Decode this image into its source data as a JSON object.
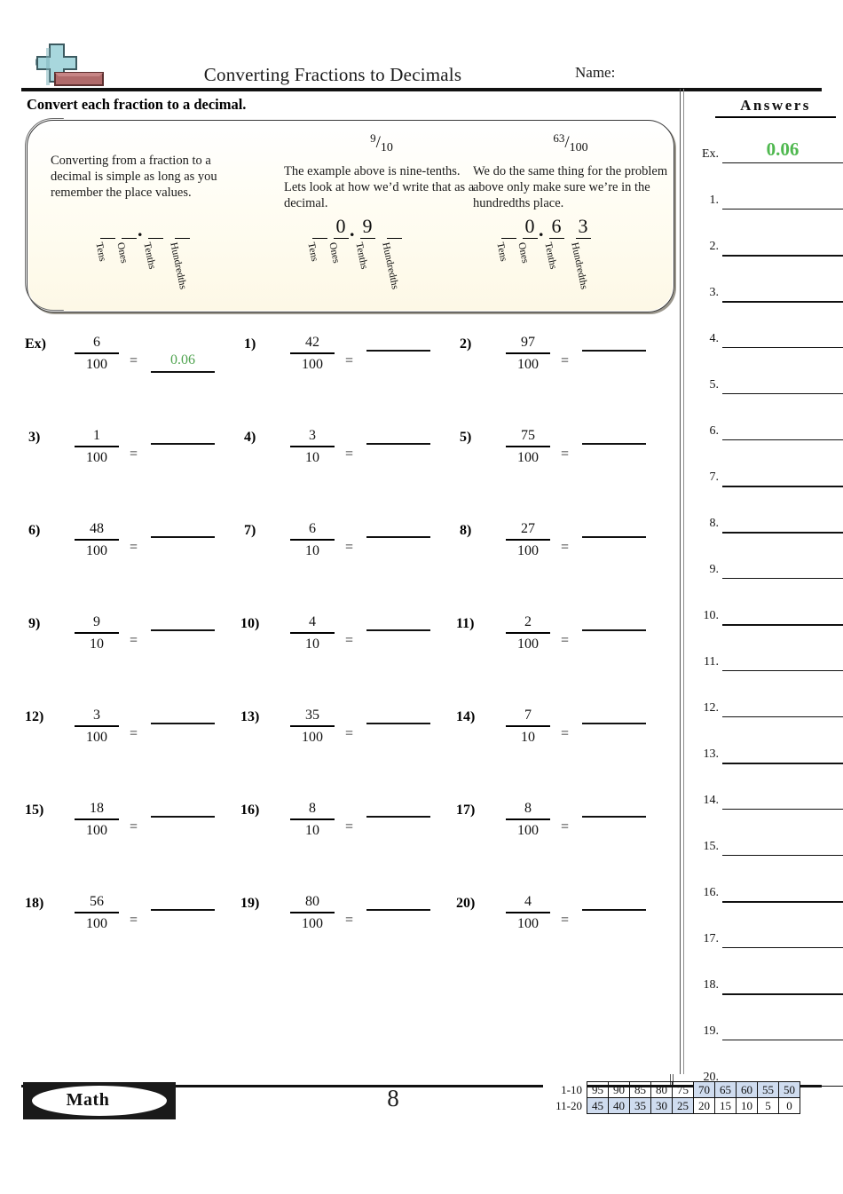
{
  "header": {
    "title": "Converting Fractions to Decimals",
    "name_label": "Name:",
    "instruction": "Convert each fraction to a decimal.",
    "logo_icon": "plus-minus-icon"
  },
  "info_box": {
    "columns": [
      {
        "fraction": null,
        "text": "Converting from a fraction to a decimal is simple as long as you remember the place values.",
        "digits": [
          "",
          "",
          "",
          ""
        ],
        "decimal_point": ".",
        "place_labels": [
          "Tens",
          "Ones",
          "Tenths",
          "Hundredths"
        ]
      },
      {
        "fraction": {
          "numerator": "9",
          "slash": "/",
          "denominator": "10"
        },
        "text": "The example above is nine-tenths. Lets look at how we’d write that as a decimal.",
        "digits": [
          "",
          "0",
          "9",
          ""
        ],
        "decimal_point": ".",
        "place_labels": [
          "Tens",
          "Ones",
          "Tenths",
          "Hundredths"
        ]
      },
      {
        "fraction": {
          "numerator": "63",
          "slash": "/",
          "denominator": "100"
        },
        "text": "We do the same thing for the problem above only make sure we’re in the hundredths place.",
        "digits": [
          "",
          "0",
          "6",
          "3"
        ],
        "decimal_point": ".",
        "place_labels": [
          "Tens",
          "Ones",
          "Tenths",
          "Hundredths"
        ]
      }
    ]
  },
  "problems": [
    {
      "label": "Ex)",
      "numerator": "6",
      "denominator": "100",
      "equals": "=",
      "answer": "0.06"
    },
    {
      "label": "1)",
      "numerator": "42",
      "denominator": "100",
      "equals": "=",
      "answer": ""
    },
    {
      "label": "2)",
      "numerator": "97",
      "denominator": "100",
      "equals": "=",
      "answer": ""
    },
    {
      "label": "3)",
      "numerator": "1",
      "denominator": "100",
      "equals": "=",
      "answer": ""
    },
    {
      "label": "4)",
      "numerator": "3",
      "denominator": "10",
      "equals": "=",
      "answer": ""
    },
    {
      "label": "5)",
      "numerator": "75",
      "denominator": "100",
      "equals": "=",
      "answer": ""
    },
    {
      "label": "6)",
      "numerator": "48",
      "denominator": "100",
      "equals": "=",
      "answer": ""
    },
    {
      "label": "7)",
      "numerator": "6",
      "denominator": "10",
      "equals": "=",
      "answer": ""
    },
    {
      "label": "8)",
      "numerator": "27",
      "denominator": "100",
      "equals": "=",
      "answer": ""
    },
    {
      "label": "9)",
      "numerator": "9",
      "denominator": "10",
      "equals": "=",
      "answer": ""
    },
    {
      "label": "10)",
      "numerator": "4",
      "denominator": "10",
      "equals": "=",
      "answer": ""
    },
    {
      "label": "11)",
      "numerator": "2",
      "denominator": "100",
      "equals": "=",
      "answer": ""
    },
    {
      "label": "12)",
      "numerator": "3",
      "denominator": "100",
      "equals": "=",
      "answer": ""
    },
    {
      "label": "13)",
      "numerator": "35",
      "denominator": "100",
      "equals": "=",
      "answer": ""
    },
    {
      "label": "14)",
      "numerator": "7",
      "denominator": "10",
      "equals": "=",
      "answer": ""
    },
    {
      "label": "15)",
      "numerator": "18",
      "denominator": "100",
      "equals": "=",
      "answer": ""
    },
    {
      "label": "16)",
      "numerator": "8",
      "denominator": "10",
      "equals": "=",
      "answer": ""
    },
    {
      "label": "17)",
      "numerator": "8",
      "denominator": "100",
      "equals": "=",
      "answer": ""
    },
    {
      "label": "18)",
      "numerator": "56",
      "denominator": "100",
      "equals": "=",
      "answer": ""
    },
    {
      "label": "19)",
      "numerator": "80",
      "denominator": "100",
      "equals": "=",
      "answer": ""
    },
    {
      "label": "20)",
      "numerator": "4",
      "denominator": "100",
      "equals": "=",
      "answer": ""
    }
  ],
  "answers_panel": {
    "title": "Answers",
    "rows": [
      {
        "label": "Ex.",
        "value": "0.06"
      },
      {
        "label": "1.",
        "value": ""
      },
      {
        "label": "2.",
        "value": ""
      },
      {
        "label": "3.",
        "value": ""
      },
      {
        "label": "4.",
        "value": ""
      },
      {
        "label": "5.",
        "value": ""
      },
      {
        "label": "6.",
        "value": ""
      },
      {
        "label": "7.",
        "value": ""
      },
      {
        "label": "8.",
        "value": ""
      },
      {
        "label": "9.",
        "value": ""
      },
      {
        "label": "10.",
        "value": ""
      },
      {
        "label": "11.",
        "value": ""
      },
      {
        "label": "12.",
        "value": ""
      },
      {
        "label": "13.",
        "value": ""
      },
      {
        "label": "14.",
        "value": ""
      },
      {
        "label": "15.",
        "value": ""
      },
      {
        "label": "16.",
        "value": ""
      },
      {
        "label": "17.",
        "value": ""
      },
      {
        "label": "18.",
        "value": ""
      },
      {
        "label": "19.",
        "value": ""
      },
      {
        "label": "20.",
        "value": ""
      }
    ],
    "answer_color": "#4fb84f"
  },
  "footer": {
    "badge_label": "Math",
    "page_number": "8",
    "score_table": {
      "rows": [
        {
          "range": "1-10",
          "cells": [
            {
              "value": "95",
              "highlighted": false
            },
            {
              "value": "90",
              "highlighted": false
            },
            {
              "value": "85",
              "highlighted": false
            },
            {
              "value": "80",
              "highlighted": false
            },
            {
              "value": "75",
              "highlighted": false
            },
            {
              "value": "70",
              "highlighted": true
            },
            {
              "value": "65",
              "highlighted": true
            },
            {
              "value": "60",
              "highlighted": true
            },
            {
              "value": "55",
              "highlighted": true
            },
            {
              "value": "50",
              "highlighted": true
            }
          ]
        },
        {
          "range": "11-20",
          "cells": [
            {
              "value": "45",
              "highlighted": true
            },
            {
              "value": "40",
              "highlighted": true
            },
            {
              "value": "35",
              "highlighted": true
            },
            {
              "value": "30",
              "highlighted": true
            },
            {
              "value": "25",
              "highlighted": true
            },
            {
              "value": "20",
              "highlighted": false
            },
            {
              "value": "15",
              "highlighted": false
            },
            {
              "value": "10",
              "highlighted": false
            },
            {
              "value": "5",
              "highlighted": false
            },
            {
              "value": "0",
              "highlighted": false
            }
          ]
        }
      ],
      "highlight_color": "#cfdcef"
    }
  }
}
